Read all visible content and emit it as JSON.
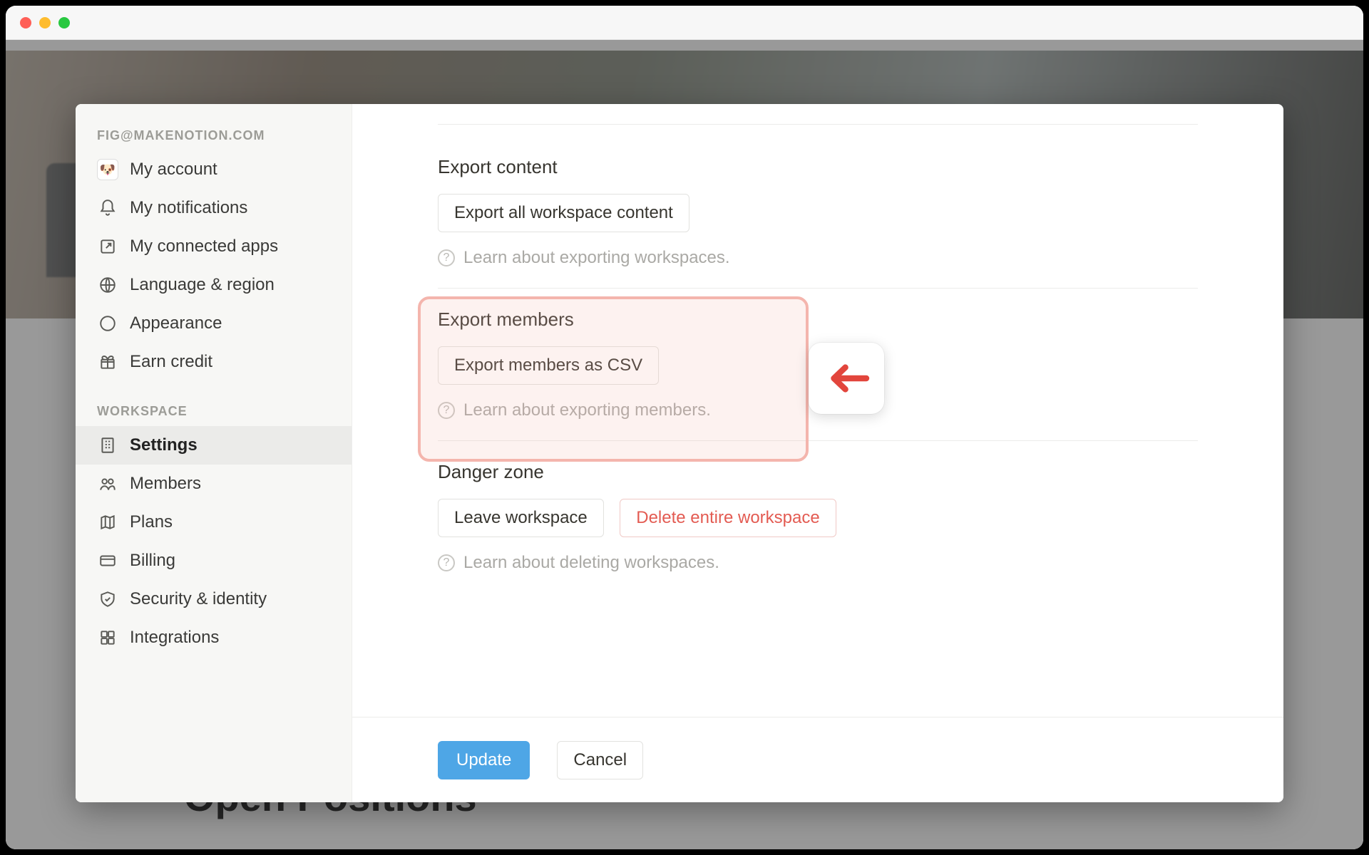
{
  "background": {
    "page_title": "Open Positions"
  },
  "sidebar": {
    "account_heading": "FIG@MAKENOTION.COM",
    "workspace_heading": "WORKSPACE",
    "account_items": [
      {
        "label": "My account"
      },
      {
        "label": "My notifications"
      },
      {
        "label": "My connected apps"
      },
      {
        "label": "Language & region"
      },
      {
        "label": "Appearance"
      },
      {
        "label": "Earn credit"
      }
    ],
    "workspace_items": [
      {
        "label": "Settings"
      },
      {
        "label": "Members"
      },
      {
        "label": "Plans"
      },
      {
        "label": "Billing"
      },
      {
        "label": "Security & identity"
      },
      {
        "label": "Integrations"
      }
    ]
  },
  "main": {
    "export_content": {
      "title": "Export content",
      "button": "Export all workspace content",
      "help": "Learn about exporting workspaces."
    },
    "export_members": {
      "title": "Export members",
      "button": "Export members as CSV",
      "help": "Learn about exporting members."
    },
    "danger": {
      "title": "Danger zone",
      "leave": "Leave workspace",
      "delete": "Delete entire workspace",
      "help": "Learn about deleting workspaces."
    }
  },
  "footer": {
    "update": "Update",
    "cancel": "Cancel"
  },
  "help_glyph": "?"
}
